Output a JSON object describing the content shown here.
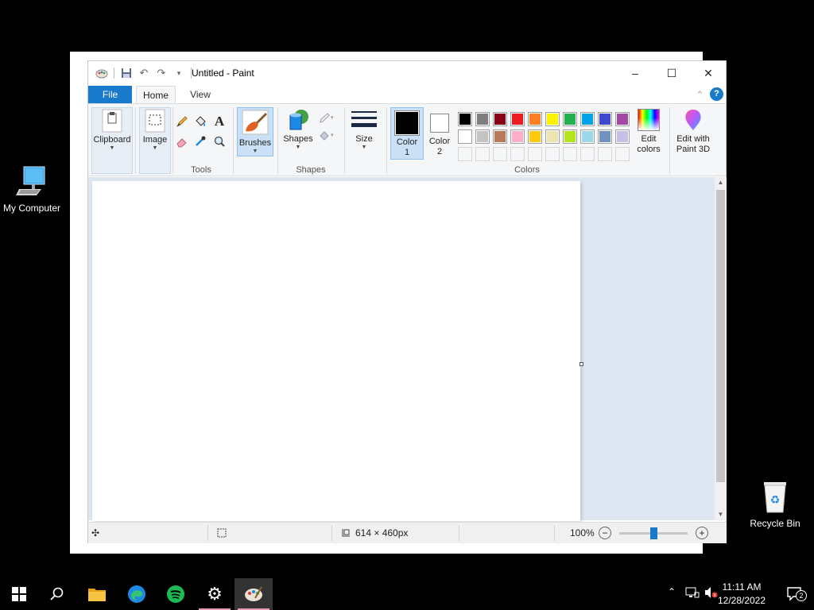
{
  "desktop": {
    "icons": [
      {
        "label": "My Computer"
      },
      {
        "label": "Recycle Bin"
      }
    ]
  },
  "window": {
    "title": "Untitled - Paint",
    "controls": {
      "minimize": "–",
      "maximize": "☐",
      "close": "✕"
    }
  },
  "ribbon": {
    "tabs": [
      "File",
      "Home",
      "View"
    ],
    "groups": {
      "clipboard": {
        "label": "Clipboard"
      },
      "image": {
        "label": "Image"
      },
      "tools": {
        "label": "Tools"
      },
      "brushes": {
        "label": "Brushes"
      },
      "shapes": {
        "label": "Shapes",
        "button": "Shapes"
      },
      "size": {
        "label": "Size"
      },
      "color1": {
        "label_line1": "Color",
        "label_line2": "1",
        "color": "#000000"
      },
      "color2": {
        "label_line1": "Color",
        "label_line2": "2",
        "color": "#ffffff"
      },
      "colors": {
        "label": "Colors"
      },
      "edit_colors": {
        "line1": "Edit",
        "line2": "colors"
      },
      "paint3d": {
        "line1": "Edit with",
        "line2": "Paint 3D"
      }
    },
    "palette_row1": [
      "#000000",
      "#7f7f7f",
      "#880015",
      "#ed1c24",
      "#ff7f27",
      "#fff200",
      "#22b14c",
      "#00a2e8",
      "#3f48cc",
      "#a349a4"
    ],
    "palette_row2": [
      "#ffffff",
      "#c3c3c3",
      "#b97a57",
      "#ffaec9",
      "#ffc90e",
      "#efe4b0",
      "#b5e61d",
      "#99d9ea",
      "#7092be",
      "#c8bfe7"
    ]
  },
  "statusbar": {
    "dimensions": "614 × 460px",
    "zoom": "100%",
    "zoom_level": 0.5
  },
  "taskbar": {
    "time": "11:11 AM",
    "date": "12/28/2022",
    "notifications": "2"
  }
}
